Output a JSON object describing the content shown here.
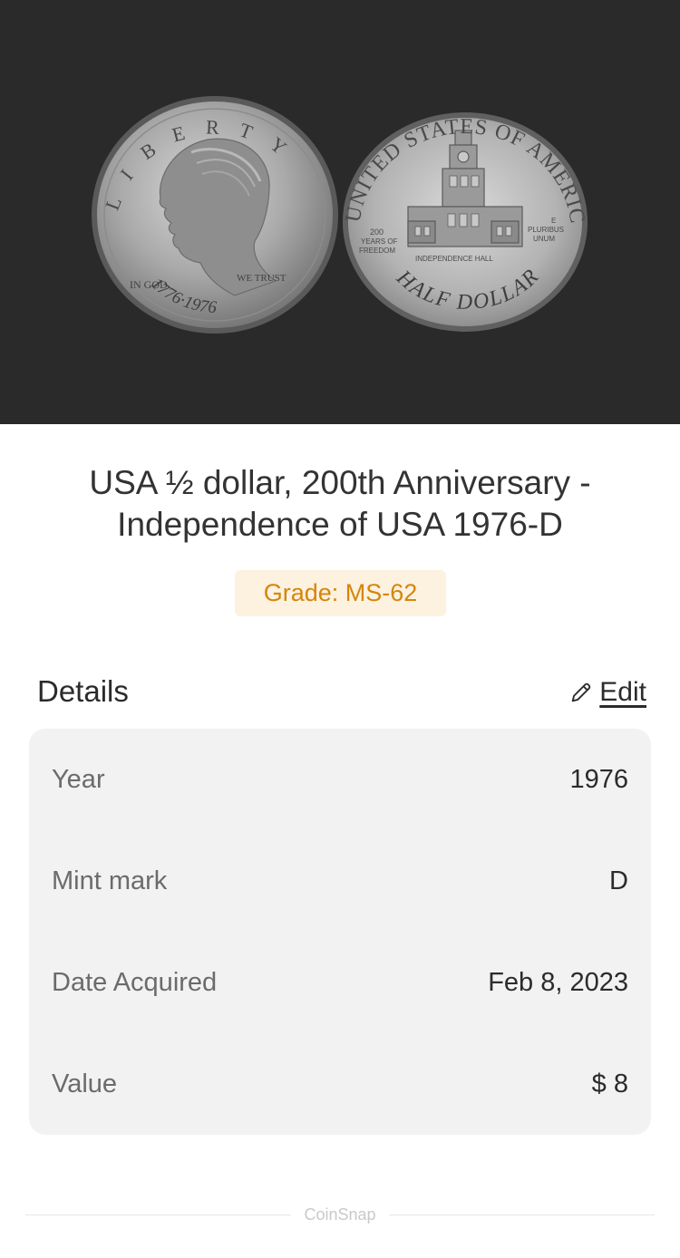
{
  "coin": {
    "title": "USA ½ dollar, 200th Anniversary - Independence of USA 1976-D",
    "title_line1": "USA ½ dollar, 200th Anniversary -",
    "title_line2": "Independence of USA 1976-D",
    "grade": "Grade: MS-62",
    "grade_color": "#d4860b",
    "grade_bg": "#fdf1e0"
  },
  "images": {
    "obverse": {
      "icon": "kennedy-half-dollar-obverse",
      "legend": "LIBERTY",
      "motto_left": "IN GOD",
      "motto_right": "WE TRUST",
      "dates": "1776·1976"
    },
    "reverse": {
      "icon": "independence-hall-reverse",
      "legend": "UNITED STATES OF AMERICA",
      "left_text_1": "200",
      "left_text_2": "YEARS OF",
      "left_text_3": "FREEDOM",
      "right_text_1": "E",
      "right_text_2": "PLURIBUS",
      "right_text_3": "UNUM",
      "building": "INDEPENDENCE HALL",
      "denomination": "HALF DOLLAR"
    }
  },
  "details": {
    "heading": "Details",
    "edit_label": "Edit",
    "edit_icon": "pencil-icon",
    "rows": [
      {
        "label": "Year",
        "value": "1976"
      },
      {
        "label": "Mint mark",
        "value": "D"
      },
      {
        "label": "Date Acquired",
        "value": "Feb 8, 2023"
      },
      {
        "label": "Value",
        "value": "$ 8"
      }
    ]
  },
  "footer": {
    "brand": "CoinSnap"
  }
}
